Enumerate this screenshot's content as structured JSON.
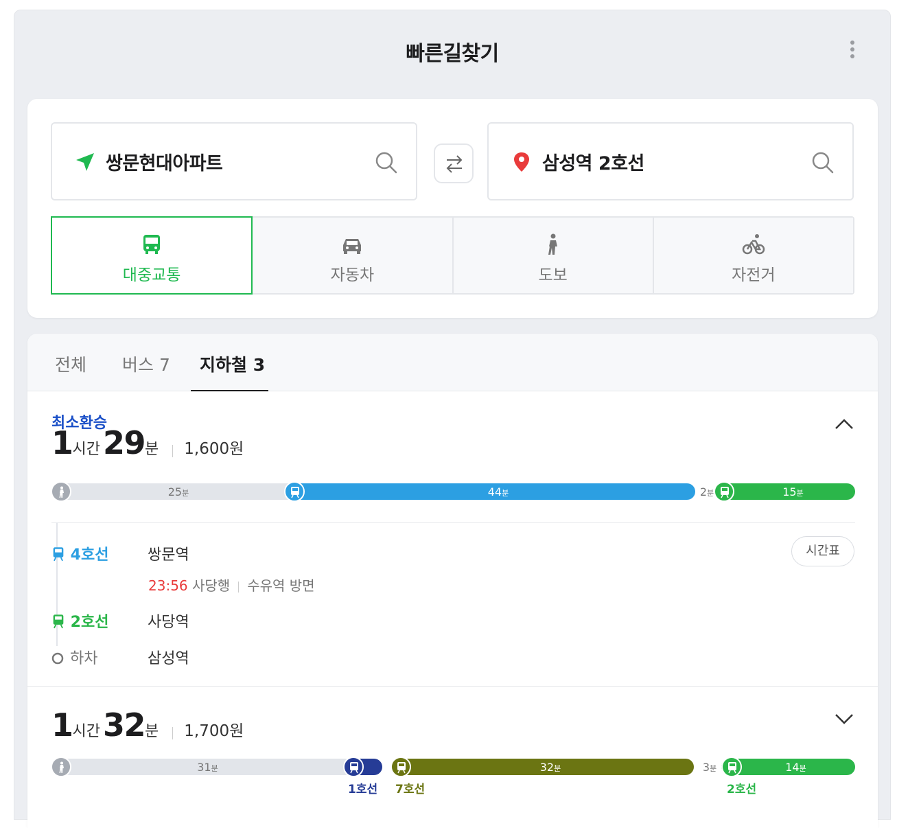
{
  "header": {
    "title": "빠른길찾기"
  },
  "search": {
    "origin": "쌍문현대아파트",
    "destination": "삼성역 2호선"
  },
  "modes": [
    {
      "label": "대중교통",
      "active": true,
      "icon": "bus-icon"
    },
    {
      "label": "자동차",
      "active": false,
      "icon": "car-icon"
    },
    {
      "label": "도보",
      "active": false,
      "icon": "walk-icon"
    },
    {
      "label": "자전거",
      "active": false,
      "icon": "bicycle-icon"
    }
  ],
  "tabs": [
    {
      "label": "전체"
    },
    {
      "label": "버스 7"
    },
    {
      "label": "지하철 3",
      "active": true
    }
  ],
  "routes": [
    {
      "badge": "최소환승",
      "hours": "1",
      "hours_unit": "시간",
      "minutes": "29",
      "minutes_unit": "분",
      "fare": "1,600원",
      "segments": [
        {
          "type": "walk",
          "minutes": "25",
          "unit": "분"
        },
        {
          "type": "subway",
          "minutes": "44",
          "unit": "분",
          "color": "#2c9fe2"
        },
        {
          "type": "walk",
          "minutes": "2",
          "unit": "분"
        },
        {
          "type": "subway",
          "minutes": "15",
          "unit": "분",
          "color": "#2bb64a"
        }
      ],
      "steps": [
        {
          "line": "4호선",
          "station": "쌍문역",
          "color": "#2c9fe2"
        },
        {
          "line": "2호선",
          "station": "사당역",
          "color": "#2bb64a"
        },
        {
          "line": "하차",
          "station": "삼성역",
          "color": "#777777"
        }
      ],
      "departure_time": "23:56",
      "direction": "사당행",
      "platform": "수유역 방면",
      "timetable_label": "시간표"
    },
    {
      "hours": "1",
      "hours_unit": "시간",
      "minutes": "32",
      "minutes_unit": "분",
      "fare": "1,700원",
      "segments": [
        {
          "type": "walk",
          "minutes": "31",
          "unit": "분"
        },
        {
          "type": "subway",
          "line": "1호선",
          "color": "#263c96"
        },
        {
          "type": "subway",
          "minutes": "32",
          "unit": "분",
          "line": "7호선",
          "color": "#6b7512"
        },
        {
          "type": "walk",
          "minutes": "3",
          "unit": "분"
        },
        {
          "type": "subway",
          "minutes": "14",
          "unit": "분",
          "line": "2호선",
          "color": "#2bb64a"
        }
      ]
    }
  ],
  "colors": {
    "accent": "#1fb950",
    "badge": "#1a4fc7",
    "time": "#e93b3b"
  }
}
